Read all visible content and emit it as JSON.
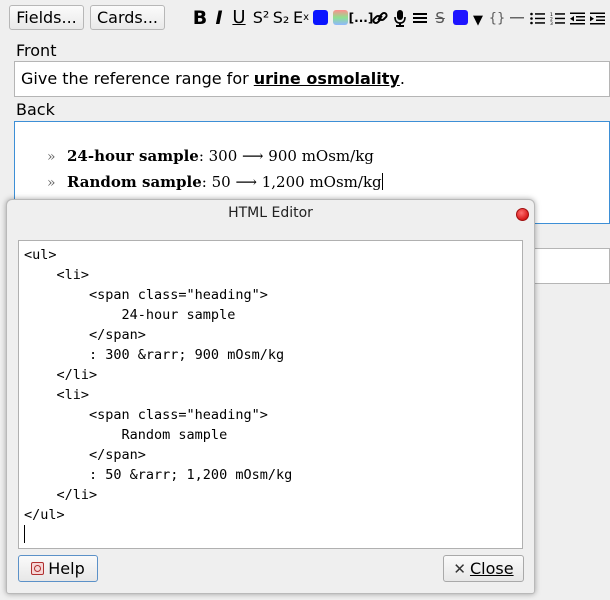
{
  "toolbar": {
    "fields_label": "Fields...",
    "cards_label": "Cards...",
    "bold": "B",
    "italic": "I",
    "underline": "U",
    "superscript": "S²",
    "subscript": "S₂",
    "clear_format": "E",
    "cloze": "[...]",
    "text_color": "#0a14ff",
    "highlight_colors": [
      "#ff8f8f",
      "#8fe08f",
      "#8fb8ff"
    ],
    "highlight_color": "#1e14ff",
    "mathjax": "{}"
  },
  "front": {
    "label": "Front",
    "text_before": "Give the reference range for ",
    "text_bold": "urine osmolality",
    "text_after": "."
  },
  "back": {
    "label": "Back",
    "items": [
      {
        "bullet": "»",
        "heading": "24-hour sample",
        "rest": ": 300 ⟶ 900 mOsm/kg"
      },
      {
        "bullet": "»",
        "heading": "Random sample",
        "rest": ": 50 ⟶ 1,200 mOsm/kg"
      }
    ]
  },
  "html_editor": {
    "title": "HTML Editor",
    "code_lines": [
      "<ul>",
      "    <li>",
      "        <span class=\"heading\">",
      "            24-hour sample",
      "        </span>",
      "        : 300 &rarr; 900 mOsm/kg",
      "    </li>",
      "    <li>",
      "        <span class=\"heading\">",
      "            Random sample",
      "        </span>",
      "        : 50 &rarr; 1,200 mOsm/kg",
      "    </li>",
      "</ul>"
    ],
    "help_label": "Help",
    "close_label": "Close"
  }
}
